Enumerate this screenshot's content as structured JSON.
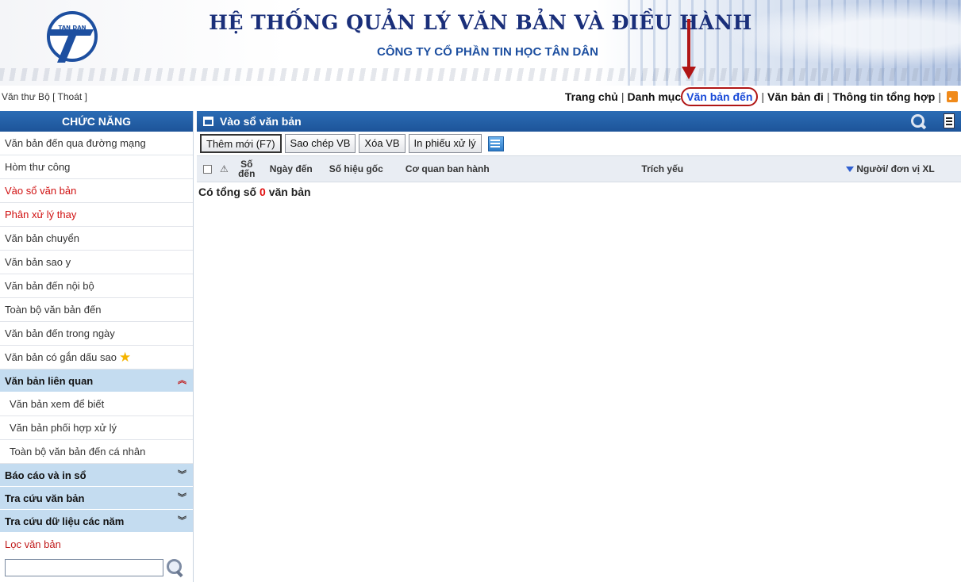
{
  "header": {
    "title": "HỆ THỐNG QUẢN LÝ VĂN BẢN VÀ ĐIỀU HÀNH",
    "subtitle": "CÔNG TY CỔ PHẦN TIN HỌC TÂN DÂN",
    "logo_text": "TAN DAN"
  },
  "user": {
    "name": "Văn thư Bộ",
    "logout": "[ Thoát ]"
  },
  "nav": {
    "sep": "|",
    "items": [
      "Trang chủ",
      "Danh mục",
      "Văn bản đến",
      "Văn bản đi",
      "Thông tin tổng hợp"
    ],
    "active": "Văn bản đến",
    "icon": "rss-icon"
  },
  "sidebar": {
    "title": "CHỨC NĂNG",
    "items": [
      "Văn bản đến qua đường mạng",
      "Hòm thư công",
      "Vào sổ văn bản",
      "Phân xử lý thay",
      "Văn bản chuyển",
      "Văn bản sao y",
      "Văn bản đến nội bộ",
      "Toàn bộ văn bản đến",
      "Văn bản đến trong ngày",
      "Văn bản có gắn dấu sao"
    ],
    "highlighted_items": [
      "Vào sổ văn bản",
      "Phân xử lý thay"
    ],
    "group_related": {
      "label": "Văn bản liên quan",
      "expand_glyph": "»",
      "items": [
        "Văn bản xem để biết",
        "Văn bản phối hợp xử lý",
        "Toàn bộ văn bản đến cá nhân"
      ]
    },
    "groups": [
      "Báo cáo và in sổ",
      "Tra cứu văn bản",
      "Tra cứu dữ liệu các năm"
    ],
    "filter_label": "Lọc văn bản",
    "filter_value": ""
  },
  "main": {
    "title": "Vào sổ văn bản",
    "buttons": [
      "Thêm mới (F7)",
      "Sao chép VB",
      "Xóa VB",
      "In phiếu xử lý"
    ],
    "columns": {
      "num_line1": "Số",
      "num_line2": "đến",
      "date": "Ngày đến",
      "code": "Số hiệu gốc",
      "org": "Cơ quan ban hành",
      "summary": "Trích yếu",
      "user": "Người/ đơn vị XL"
    },
    "total_prefix": "Có tổng số",
    "total_count": "0",
    "total_suffix": "văn bản"
  },
  "colors": {
    "header_blue": "#1d5499",
    "group_bg": "#c4dcf0",
    "highlight_red": "#d01010",
    "active_link": "#1a4bd8"
  }
}
